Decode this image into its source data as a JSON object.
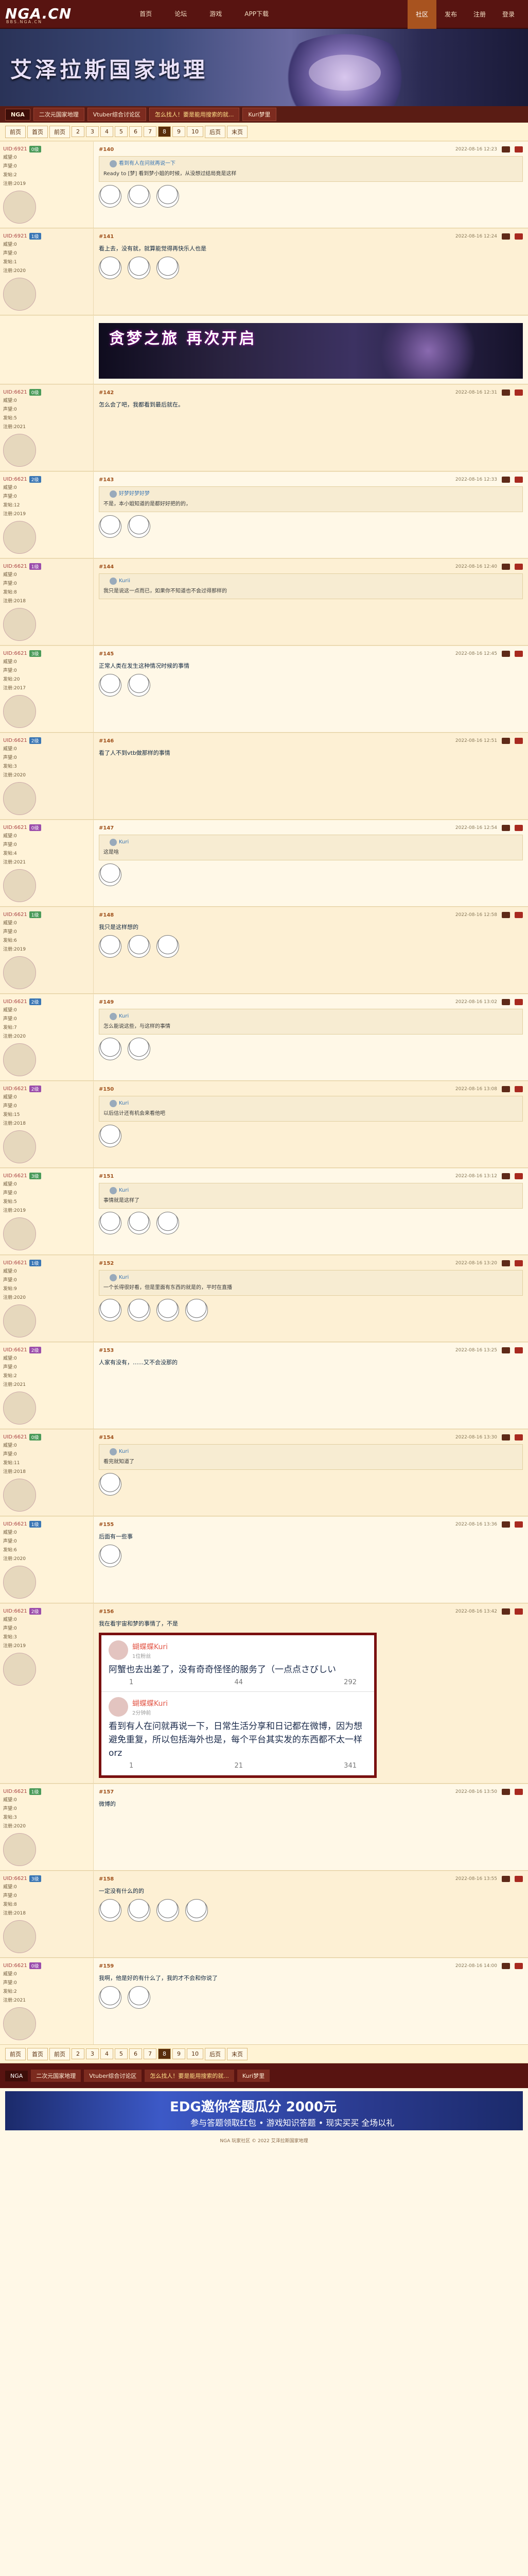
{
  "site": {
    "logo": "NGA.CN",
    "logo_sub": "BBS.NGA.CN",
    "nav": [
      "首页",
      "论坛",
      "游戏",
      "APP下载"
    ],
    "right": [
      "社区",
      "发布",
      "注册",
      "登录"
    ]
  },
  "banner": {
    "title": "艾泽拉斯国家地理"
  },
  "forumbar": {
    "items": [
      "NGA",
      "二次元国家地理",
      "Vtuber综合讨论区",
      "怎么找人！要是能用搜索的就...",
      "Kuri梦里"
    ]
  },
  "pager": {
    "items": [
      "前页",
      "首页",
      "前页",
      "2",
      "3",
      "4",
      "5",
      "6",
      "7",
      "8",
      "9",
      "10",
      "后页",
      "末页"
    ],
    "current": "8"
  },
  "posts": [
    {
      "uid": "UID:6921",
      "lvl": "0级",
      "badge": "",
      "fame": "威望:0",
      "rank": "声望:0",
      "posts": "发帖:2",
      "reg": "注册:2019",
      "floor": "#140",
      "time": "2022-08-16 12:23",
      "quote_name": "看到有人在问就再说一下",
      "text": "Ready to [梦] 看到梦小姐的时候，从没想过结局竟是这样",
      "stickers": 3
    },
    {
      "uid": "UID:6921",
      "lvl": "1级",
      "badge": "",
      "fame": "威望:0",
      "rank": "声望:0",
      "posts": "发帖:1",
      "reg": "注册:2020",
      "floor": "#141",
      "time": "2022-08-16 12:24",
      "text": "看上去，没有就，就算能觉得再快乐人也是",
      "stickers": 3
    },
    {
      "uid": "",
      "lvl": "",
      "badge": "",
      "fame": "",
      "rank": "",
      "posts": "",
      "reg": "",
      "floor": "",
      "time": "",
      "banner_text": "贪梦之旅 再次开启",
      "stickers": 0
    },
    {
      "uid": "UID:6621",
      "lvl": "0级",
      "fame": "威望:0",
      "rank": "声望:0",
      "posts": "发帖:5",
      "reg": "注册:2021",
      "floor": "#142",
      "time": "2022-08-16 12:31",
      "text": "怎么会了吧，我都看到最后就在。",
      "stickers": 0
    },
    {
      "uid": "UID:6621",
      "lvl": "2级",
      "fame": "威望:0",
      "rank": "声望:0",
      "posts": "发帖:12",
      "reg": "注册:2019",
      "floor": "#143",
      "time": "2022-08-16 12:33",
      "quote_name": "好梦好梦好梦",
      "text": "不是，本小姐知道的是都好好把的的，",
      "stickers": 2
    },
    {
      "uid": "UID:6621",
      "lvl": "1级",
      "fame": "威望:0",
      "rank": "声望:0",
      "posts": "发帖:8",
      "reg": "注册:2018",
      "floor": "#144",
      "time": "2022-08-16 12:40",
      "quote_name": "Kurii",
      "text": "我只是说这一点而已，如果你不知道也不会过得那样的",
      "stickers": 0
    },
    {
      "uid": "UID:6621",
      "lvl": "3级",
      "fame": "威望:0",
      "rank": "声望:0",
      "posts": "发帖:20",
      "reg": "注册:2017",
      "floor": "#145",
      "time": "2022-08-16 12:45",
      "text": "正常人类在发生这种情况时候的事情",
      "stickers": 2
    },
    {
      "uid": "UID:6621",
      "lvl": "2级",
      "fame": "威望:0",
      "rank": "声望:0",
      "posts": "发帖:3",
      "reg": "注册:2020",
      "floor": "#146",
      "time": "2022-08-16 12:51",
      "text": "看了人不到vtb做那样的事情",
      "stickers": 0
    },
    {
      "uid": "UID:6621",
      "lvl": "0级",
      "fame": "威望:0",
      "rank": "声望:0",
      "posts": "发帖:4",
      "reg": "注册:2021",
      "floor": "#147",
      "time": "2022-08-16 12:54",
      "quote_name": "Kuri",
      "text": "这是啥",
      "stickers": 1
    },
    {
      "uid": "UID:6621",
      "lvl": "1级",
      "fame": "威望:0",
      "rank": "声望:0",
      "posts": "发帖:6",
      "reg": "注册:2019",
      "floor": "#148",
      "time": "2022-08-16 12:58",
      "text": "我只是这样想的",
      "stickers": 3
    },
    {
      "uid": "UID:6621",
      "lvl": "2级",
      "fame": "威望:0",
      "rank": "声望:0",
      "posts": "发帖:7",
      "reg": "注册:2020",
      "floor": "#149",
      "time": "2022-08-16 13:02",
      "quote_name": "Kuri",
      "text": "怎么能说这些，与这样的事情",
      "stickers": 2
    },
    {
      "uid": "UID:6621",
      "lvl": "2级",
      "fame": "威望:0",
      "rank": "声望:0",
      "posts": "发帖:15",
      "reg": "注册:2018",
      "floor": "#150",
      "time": "2022-08-16 13:08",
      "quote_name": "Kuri",
      "text": "以后估计还有机会来看他吧",
      "stickers": 1
    },
    {
      "uid": "UID:6621",
      "lvl": "3级",
      "fame": "威望:0",
      "rank": "声望:0",
      "posts": "发帖:5",
      "reg": "注册:2019",
      "floor": "#151",
      "time": "2022-08-16 13:12",
      "quote_name": "Kuri",
      "text": "事情就是这样了",
      "stickers": 3
    },
    {
      "uid": "UID:6621",
      "lvl": "1级",
      "fame": "威望:0",
      "rank": "声望:0",
      "posts": "发帖:9",
      "reg": "注册:2020",
      "floor": "#152",
      "time": "2022-08-16 13:20",
      "quote_name": "Kuri",
      "text": "一个长得很好看，但是里面有东西的就是的，平时在直播",
      "stickers": 4
    },
    {
      "uid": "UID:6621",
      "lvl": "2级",
      "fame": "威望:0",
      "rank": "声望:0",
      "posts": "发帖:2",
      "reg": "注册:2021",
      "floor": "#153",
      "time": "2022-08-16 13:25",
      "text": "人家有没有，......又不会没那的",
      "stickers": 0
    },
    {
      "uid": "UID:6621",
      "lvl": "0级",
      "fame": "威望:0",
      "rank": "声望:0",
      "posts": "发帖:11",
      "reg": "注册:2018",
      "floor": "#154",
      "time": "2022-08-16 13:30",
      "quote_name": "Kuri",
      "text": "看完就知道了",
      "stickers": 1
    },
    {
      "uid": "UID:6621",
      "lvl": "1级",
      "fame": "威望:0",
      "rank": "声望:0",
      "posts": "发帖:6",
      "reg": "注册:2020",
      "floor": "#155",
      "time": "2022-08-16 13:36",
      "text": "后面有一些事",
      "stickers": 1
    },
    {
      "uid": "UID:6621",
      "lvl": "2级",
      "fame": "威望:0",
      "rank": "声望:0",
      "posts": "发帖:3",
      "reg": "注册:2019",
      "floor": "#156",
      "time": "2022-08-16 13:42",
      "text": "我在看宇宙和梦的事情了，不是",
      "stickers": 0,
      "tweet": {
        "name1": "蝴蝶蝶Kuri",
        "meta1": "1位粉丝",
        "text1": "阿蟹也去出差了，没有奇奇怪怪的服务了（一点点さびしい",
        "a1": [
          "1",
          "44",
          "292"
        ],
        "name2": "蝴蝶蝶Kuri",
        "meta2": "2分钟前",
        "text2": "看到有人在问就再说一下，日常生活分享和日记都在微博，因为想避免重复，所以包括海外也是，每个平台其实发的东西都不太一样orz",
        "a2": [
          "1",
          "21",
          "341"
        ]
      }
    },
    {
      "uid": "UID:6621",
      "lvl": "1级",
      "fame": "威望:0",
      "rank": "声望:0",
      "posts": "发帖:3",
      "reg": "注册:2020",
      "floor": "#157",
      "time": "2022-08-16 13:50",
      "text": "微博的",
      "stickers": 0
    },
    {
      "uid": "UID:6621",
      "lvl": "3级",
      "fame": "威望:0",
      "rank": "声望:0",
      "posts": "发帖:8",
      "reg": "注册:2018",
      "floor": "#158",
      "time": "2022-08-16 13:55",
      "text": "一定没有什么的的",
      "stickers": 4
    },
    {
      "uid": "UID:6621",
      "lvl": "0级",
      "fame": "威望:0",
      "rank": "声望:0",
      "posts": "发帖:2",
      "reg": "注册:2021",
      "floor": "#159",
      "time": "2022-08-16 14:00",
      "text": "我啊，他是好的有什么了，我的才不会和你说了",
      "stickers": 2
    }
  ],
  "ad": {
    "title": "EDG邀你答题瓜分 2000元",
    "sub": "参与答题领取红包 • 游戏知识答题 • 现实买买 全场以礼"
  },
  "copyright": "NGA 玩家社区 © 2022 艾泽拉斯国家地理"
}
